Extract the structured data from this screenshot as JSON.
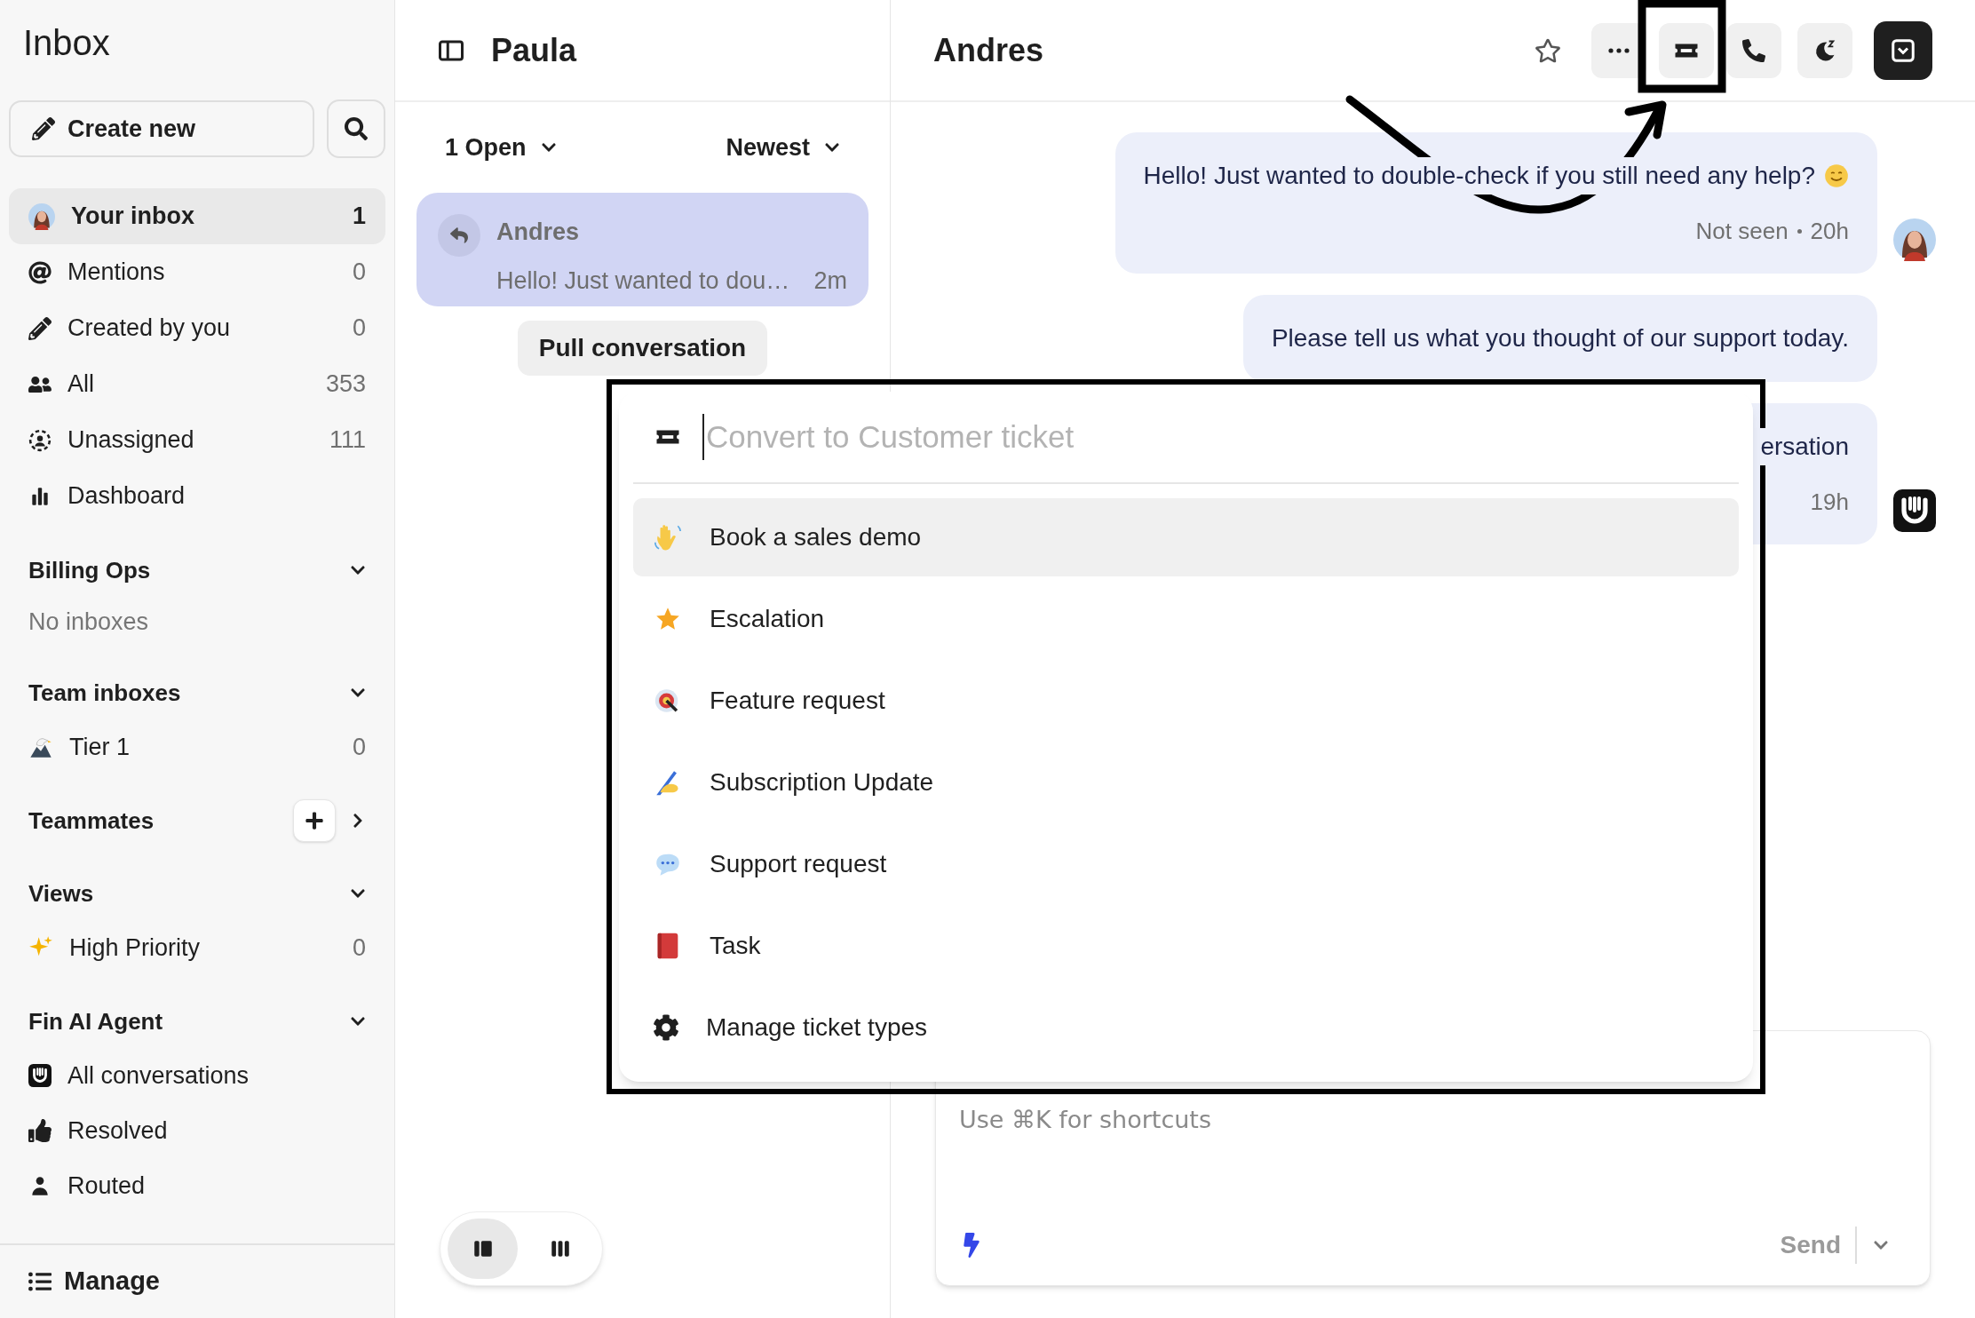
{
  "sidebar": {
    "title": "Inbox",
    "create_button": "Create new",
    "nav": [
      {
        "label": "Your inbox",
        "count": "1",
        "selected": true
      },
      {
        "label": "Mentions",
        "count": "0",
        "selected": false
      },
      {
        "label": "Created by you",
        "count": "0",
        "selected": false
      },
      {
        "label": "All",
        "count": "353",
        "selected": false
      },
      {
        "label": "Unassigned",
        "count": "111",
        "selected": false
      },
      {
        "label": "Dashboard",
        "selected": false
      }
    ],
    "sections": [
      {
        "title": "Billing Ops",
        "expanded": true,
        "add_button": false,
        "empty_text": "No inboxes"
      },
      {
        "title": "Team inboxes",
        "expanded": true,
        "add_button": false,
        "items": [
          {
            "label": "Tier 1",
            "count": "0"
          }
        ]
      },
      {
        "title": "Teammates",
        "expanded": false,
        "add_button": true
      },
      {
        "title": "Views",
        "expanded": true,
        "add_button": false,
        "items": [
          {
            "label": "High Priority",
            "count": "0"
          }
        ]
      },
      {
        "title": "Fin AI Agent",
        "expanded": true,
        "add_button": false,
        "items": [
          {
            "label": "All conversations"
          },
          {
            "label": "Resolved"
          },
          {
            "label": "Routed"
          }
        ]
      }
    ],
    "manage": "Manage"
  },
  "conversations": {
    "title": "Paula",
    "status_filter": "1 Open",
    "sort": "Newest",
    "items": [
      {
        "name": "Andres",
        "preview": "Hello! Just wanted to dou…",
        "time": "2m",
        "selected": true
      }
    ],
    "pull_button": "Pull conversation",
    "layout_options": [
      {
        "selected": true
      },
      {
        "selected": false
      }
    ]
  },
  "conversation": {
    "title": "Andres",
    "messages": [
      {
        "kind": "agent",
        "text": "Hello! Just wanted to double-check if you still need any help?",
        "status": "Not seen",
        "time": "20h"
      },
      {
        "kind": "plain",
        "text": "Please tell us what you thought of our support today."
      },
      {
        "kind": "bot",
        "text": "ersation",
        "time": "19h"
      }
    ],
    "composer": {
      "placeholder": "Use ⌘K for shortcuts",
      "send": "Send"
    }
  },
  "popup": {
    "placeholder": "Convert to Customer ticket",
    "items": [
      {
        "label": "Book a sales demo",
        "selected": true
      },
      {
        "label": "Escalation",
        "selected": false
      },
      {
        "label": "Feature request",
        "selected": false
      },
      {
        "label": "Subscription Update",
        "selected": false
      },
      {
        "label": "Support request",
        "selected": false
      },
      {
        "label": "Task",
        "selected": false
      },
      {
        "label": "Manage ticket types",
        "selected": false
      }
    ]
  }
}
